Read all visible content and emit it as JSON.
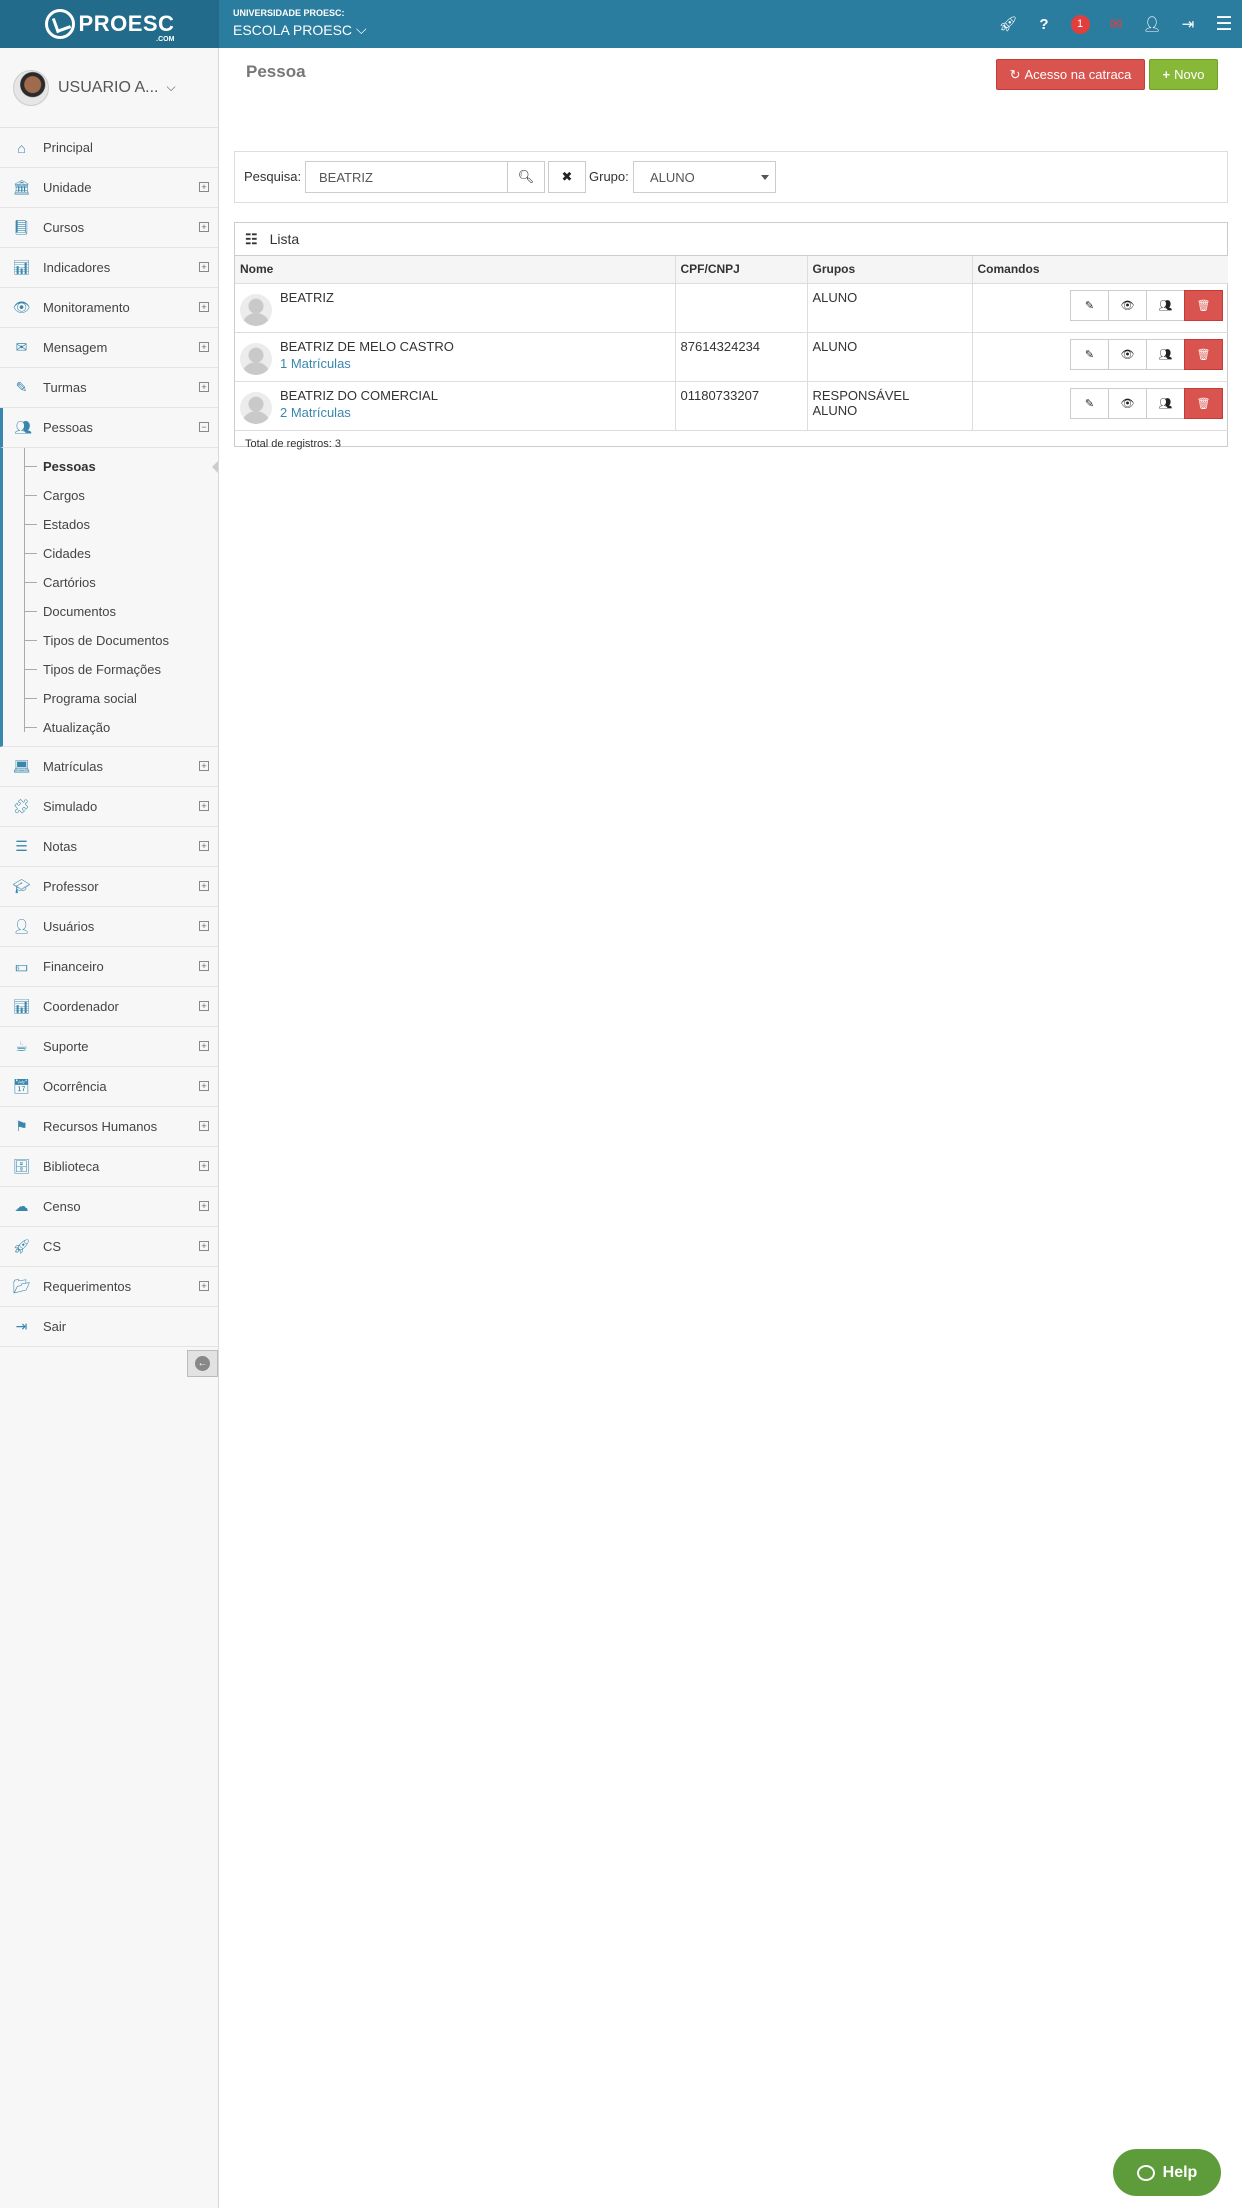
{
  "header": {
    "org_top": "UNIVERSIDADE PROESC:",
    "org_name": "ESCOLA PROESC",
    "logo_text": "PROESC",
    "logo_sub": ".COM",
    "notification_count": "1",
    "icons": [
      "rocket-icon",
      "question-icon",
      "notifications-badge",
      "envelope-icon",
      "user-icon",
      "sign-out-icon",
      "hamburger-menu-icon"
    ]
  },
  "sidebar": {
    "user_name": "USUARIO A...",
    "items_top": [
      {
        "label": "Principal",
        "icon": "home-icon",
        "expand": false
      },
      {
        "label": "Unidade",
        "icon": "bank-icon",
        "expand": true
      },
      {
        "label": "Cursos",
        "icon": "book-icon",
        "expand": true
      },
      {
        "label": "Indicadores",
        "icon": "bar-chart-icon",
        "expand": true
      },
      {
        "label": "Monitoramento",
        "icon": "eye-icon",
        "expand": true
      },
      {
        "label": "Mensagem",
        "icon": "envelope-icon",
        "expand": true
      },
      {
        "label": "Turmas",
        "icon": "pencil-icon",
        "expand": true
      }
    ],
    "active": {
      "label": "Pessoas",
      "icon": "users-icon"
    },
    "submenu": [
      "Pessoas",
      "Cargos",
      "Estados",
      "Cidades",
      "Cartórios",
      "Documentos",
      "Tipos de Documentos",
      "Tipos de Formações",
      "Programa social",
      "Atualização"
    ],
    "items_bottom": [
      {
        "label": "Matrículas",
        "icon": "laptop-icon",
        "expand": true
      },
      {
        "label": "Simulado",
        "icon": "puzzle-icon",
        "expand": true
      },
      {
        "label": "Notas",
        "icon": "list-icon",
        "expand": true
      },
      {
        "label": "Professor",
        "icon": "graduation-cap-icon",
        "expand": true
      },
      {
        "label": "Usuários",
        "icon": "user-icon",
        "expand": true
      },
      {
        "label": "Financeiro",
        "icon": "money-icon",
        "expand": true
      },
      {
        "label": "Coordenador",
        "icon": "bar-chart-icon",
        "expand": true
      },
      {
        "label": "Suporte",
        "icon": "coffee-icon",
        "expand": true
      },
      {
        "label": "Ocorrência",
        "icon": "calendar-icon",
        "expand": true
      },
      {
        "label": "Recursos Humanos",
        "icon": "flag-icon",
        "expand": true
      },
      {
        "label": "Biblioteca",
        "icon": "archive-icon",
        "expand": true
      },
      {
        "label": "Censo",
        "icon": "cloud-download-icon",
        "expand": true
      },
      {
        "label": "CS",
        "icon": "rocket-icon",
        "expand": true
      },
      {
        "label": "Requerimentos",
        "icon": "folder-open-icon",
        "expand": true
      },
      {
        "label": "Sair",
        "icon": "sign-out-icon",
        "expand": false
      }
    ]
  },
  "main": {
    "title": "Pessoa",
    "btn_catraca": "Acesso na catraca",
    "btn_novo": "Novo",
    "search_label": "Pesquisa:",
    "search_value": "BEATRIZ",
    "group_label": "Grupo:",
    "group_value": "ALUNO",
    "list_title": "Lista",
    "columns": [
      "Nome",
      "CPF/CNPJ",
      "Grupos",
      "Comandos"
    ],
    "rows": [
      {
        "name": "BEATRIZ",
        "link": "",
        "cpf": "",
        "groups": [
          "ALUNO"
        ]
      },
      {
        "name": "BEATRIZ DE MELO CASTRO",
        "link": "1 Matrículas",
        "cpf": "87614324234",
        "groups": [
          "ALUNO"
        ]
      },
      {
        "name": "BEATRIZ DO COMERCIAL",
        "link": "2 Matrículas",
        "cpf": "01180733207",
        "groups": [
          "RESPONSÁVEL",
          "ALUNO"
        ]
      }
    ],
    "total": "Total de registros: 3"
  },
  "help_label": "Help",
  "colors": {
    "primary": "#2b7d9f",
    "accent": "#3a87ad",
    "danger": "#d9534f",
    "success": "#87b837",
    "help": "#5e9c3b"
  }
}
